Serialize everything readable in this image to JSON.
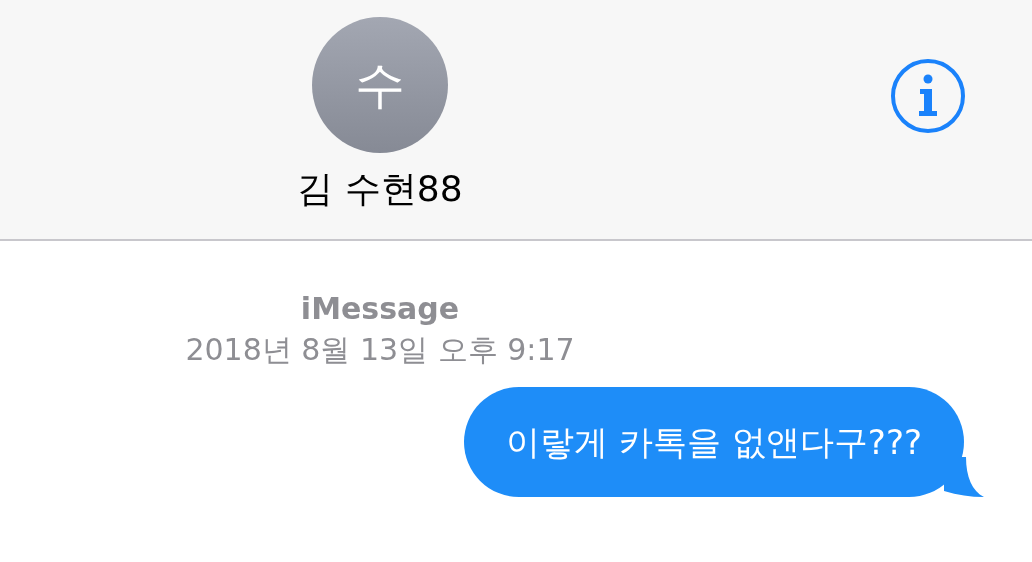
{
  "header": {
    "avatar_initial": "수",
    "contact_name": "김 수현88"
  },
  "conversation": {
    "service": "iMessage",
    "timestamp": "2018년 8월 13일 오후 9:17",
    "messages": [
      {
        "kind": "sent",
        "text": "이랗게 카톡을 없앤다구???"
      }
    ]
  }
}
